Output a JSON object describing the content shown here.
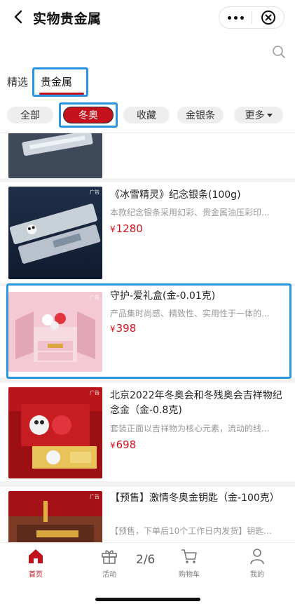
{
  "header": {
    "title": "实物贵金属"
  },
  "tabs": [
    {
      "label": "精选"
    },
    {
      "label": "贵金属"
    }
  ],
  "filters": [
    {
      "label": "全部"
    },
    {
      "label": "冬奥"
    },
    {
      "label": "收藏"
    },
    {
      "label": "金银条"
    },
    {
      "label": "更多"
    }
  ],
  "products": [
    {
      "title": "《冰雪精灵》纪念银条(100g)",
      "desc": "本款纪念银条采用幻彩、贵金属油压彩印...",
      "currency": "¥",
      "price": "1280",
      "ad": "广告"
    },
    {
      "title": "守护-爱礼盒(金-0.01克)",
      "desc": "产品集时尚感、精致性、实用性于一体的...",
      "currency": "¥",
      "price": "398",
      "ad": "广告"
    },
    {
      "title": "北京2022年冬奥会和冬残奥会吉祥物纪念金（金-0.8克)",
      "desc": "套装正面以吉祥物为核心元素，流动的线...",
      "currency": "¥",
      "price": "698",
      "ad": "广告"
    },
    {
      "title": "【预售】激情冬奥金钥匙（金-100克）",
      "desc": "【预售，下单后10个工作日内发货】钥匙...",
      "ad": "广告"
    }
  ],
  "tabbar": {
    "home": "首页",
    "activity": "活动",
    "pager": "2/6",
    "cart": "购物车",
    "mine": "我的"
  },
  "colors": {
    "brand_red": "#c4111b",
    "highlight_blue": "#2a94e0"
  },
  "icons": [
    "back-icon",
    "more-icon",
    "close-icon",
    "search-icon",
    "home-icon",
    "gift-icon",
    "cart-icon",
    "user-icon"
  ]
}
